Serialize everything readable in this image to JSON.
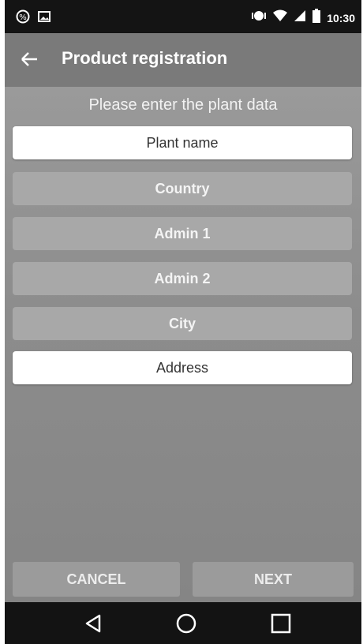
{
  "status_bar": {
    "left_icons": [
      "data-saver-icon",
      "image-icon"
    ],
    "right_icons": [
      "vibrate-icon",
      "wifi-icon",
      "signal-icon",
      "battery-icon"
    ],
    "time": "10:30"
  },
  "app_bar": {
    "back_icon": "arrow-left-icon",
    "title": "Product registration"
  },
  "form": {
    "prompt": "Please enter the plant data",
    "fields": [
      {
        "label": "Plant name"
      },
      {
        "label": "Country"
      },
      {
        "label": "Admin 1"
      },
      {
        "label": "Admin 2"
      },
      {
        "label": "City"
      },
      {
        "label": "Address"
      }
    ]
  },
  "actions": {
    "cancel_label": "CANCEL",
    "next_label": "NEXT"
  },
  "nav_bar": {
    "icons": [
      "back-triangle-icon",
      "home-circle-icon",
      "recents-square-icon"
    ]
  }
}
